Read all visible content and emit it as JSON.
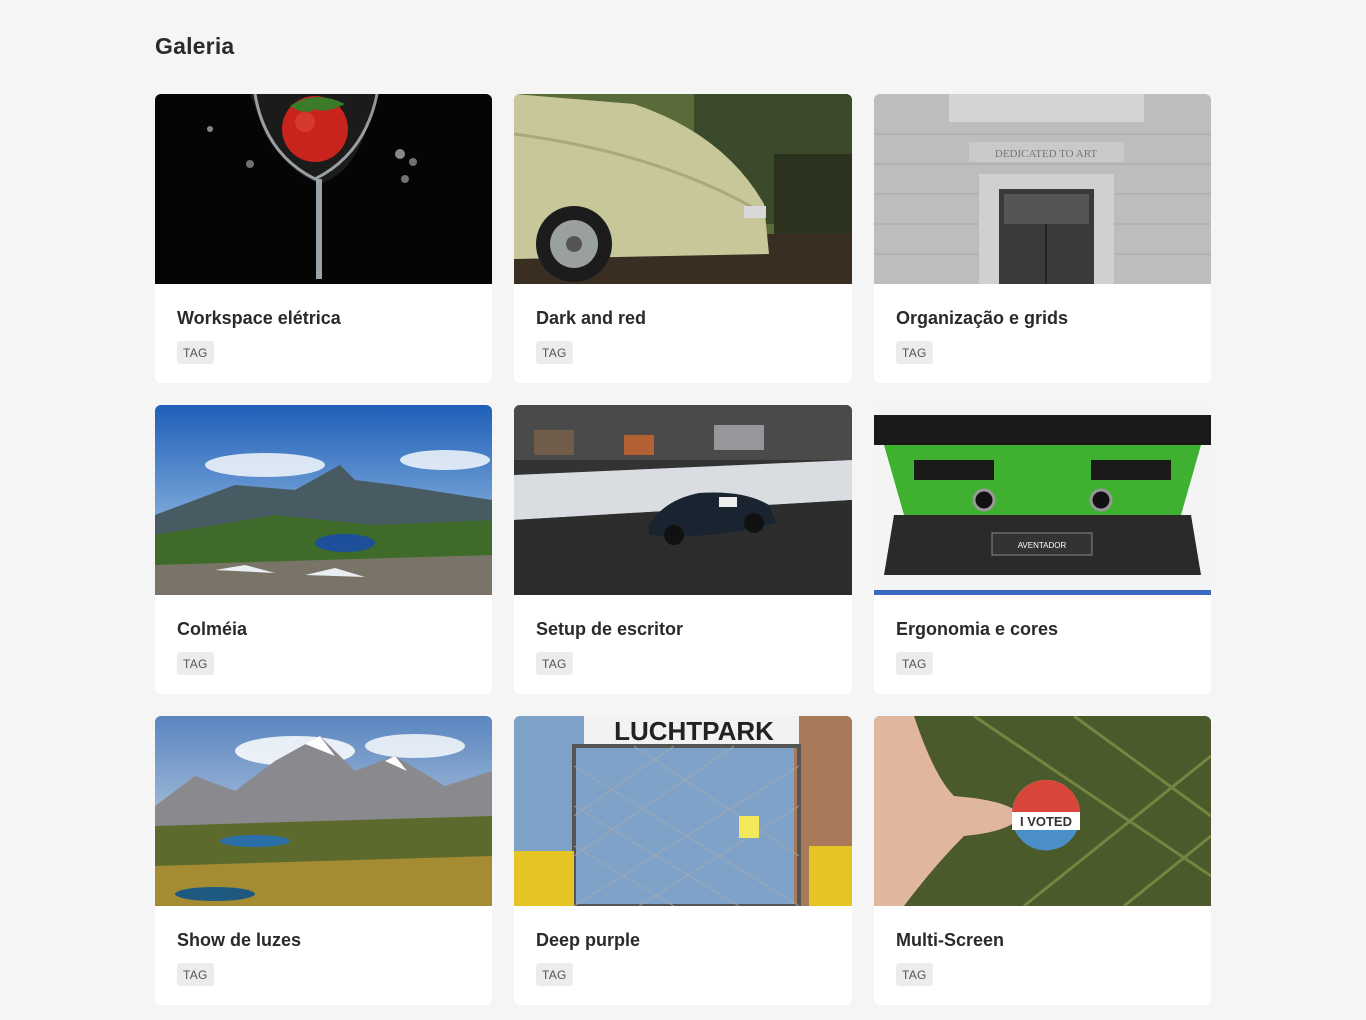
{
  "page": {
    "title": "Galeria"
  },
  "cards": [
    {
      "title": "Workspace elétrica",
      "tag": "TAG",
      "image": "strawberry-in-glass"
    },
    {
      "title": "Dark and red",
      "tag": "TAG",
      "image": "vintage-car"
    },
    {
      "title": "Organização e grids",
      "tag": "TAG",
      "image": "stone-building-door"
    },
    {
      "title": "Colméia",
      "tag": "TAG",
      "image": "mountain-lake"
    },
    {
      "title": "Setup de escritor",
      "tag": "TAG",
      "image": "racing-car"
    },
    {
      "title": "Ergonomia e cores",
      "tag": "TAG",
      "image": "green-sports-car"
    },
    {
      "title": "Show de luzes",
      "tag": "TAG",
      "image": "alpine-peaks"
    },
    {
      "title": "Deep purple",
      "tag": "TAG",
      "image": "park-fence"
    },
    {
      "title": "Multi-Screen",
      "tag": "TAG",
      "image": "voted-sticker"
    }
  ],
  "sticker_text": "I VOTED",
  "sign_text": "LUCHTPARK",
  "inscription_text": "DEDICATED TO ART"
}
